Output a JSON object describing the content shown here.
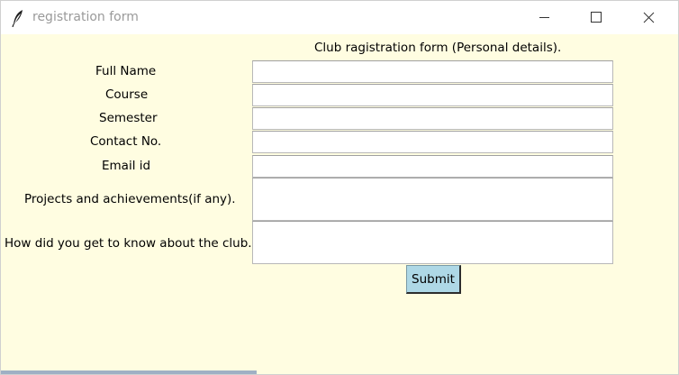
{
  "window": {
    "title": "registration form",
    "icon": "feather-icon",
    "controls": [
      "minimize-icon",
      "maximize-icon",
      "close-icon"
    ]
  },
  "form": {
    "header": "Club ragistration form (Personal details).",
    "labels": {
      "full_name": "Full Name",
      "course": "Course",
      "semester": "Semester",
      "contact": "Contact No.",
      "email": "Email id",
      "projects": "Projects and achievements(if any).",
      "how_know": "How did you get to know about the club."
    },
    "values": {
      "full_name": "",
      "course": "",
      "semester": "",
      "contact": "",
      "email": "",
      "projects": "",
      "how_know": ""
    },
    "submit_label": "Submit"
  },
  "colors": {
    "background": "#fffde1",
    "submit_button": "#aed8e6"
  }
}
